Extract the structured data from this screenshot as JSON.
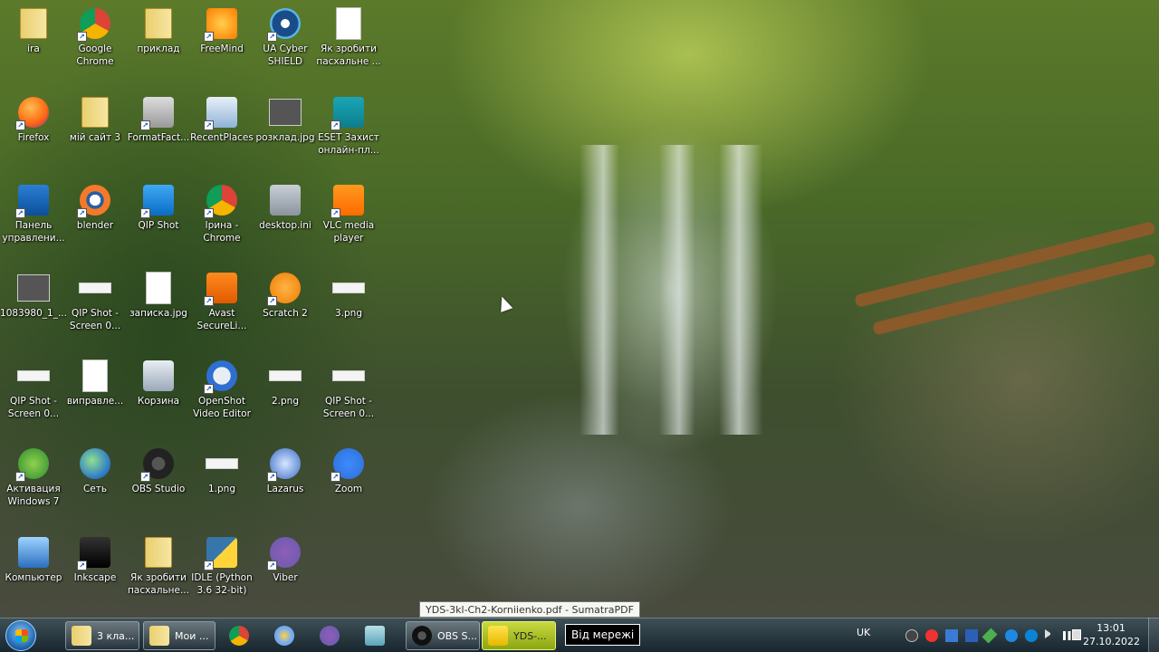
{
  "desktop": {
    "icons": [
      {
        "label": "ira",
        "icon": "user-folder-icon"
      },
      {
        "label": "Firefox",
        "icon": "firefox-icon",
        "shortcut": true
      },
      {
        "label": "Панель\nуправлени...",
        "icon": "control-panel-icon",
        "shortcut": true
      },
      {
        "label": "1083980_1_...",
        "icon": "image-thumbnail-icon"
      },
      {
        "label": "QIP Shot -\nScreen 0...",
        "icon": "screenshot-thumbnail-icon"
      },
      {
        "label": "Активация\nWindows 7",
        "icon": "activation-icon",
        "shortcut": true
      },
      {
        "label": "Компьютер",
        "icon": "computer-icon"
      },
      {
        "label": "Google\nChrome",
        "icon": "chrome-icon",
        "shortcut": true
      },
      {
        "label": "мій сайт 3",
        "icon": "folder-icon"
      },
      {
        "label": "blender",
        "icon": "blender-icon",
        "shortcut": true
      },
      {
        "label": "QIP Shot -\nScreen 0...",
        "icon": "screenshot-thumbnail-icon"
      },
      {
        "label": "виправле...",
        "icon": "document-thumbnail-icon"
      },
      {
        "label": "Сеть",
        "icon": "network-globe-icon"
      },
      {
        "label": "Inkscape",
        "icon": "inkscape-icon",
        "shortcut": true
      },
      {
        "label": "приклад",
        "icon": "folder-icon"
      },
      {
        "label": "FormatFact...",
        "icon": "format-factory-icon",
        "shortcut": true
      },
      {
        "label": "QIP Shot",
        "icon": "qip-shot-icon",
        "shortcut": true
      },
      {
        "label": "записка.jpg",
        "icon": "document-thumbnail-icon"
      },
      {
        "label": "Корзина",
        "icon": "recycle-bin-icon"
      },
      {
        "label": "OBS Studio",
        "icon": "obs-icon",
        "shortcut": true
      },
      {
        "label": "Як зробити\nпасхальне...",
        "icon": "folder-icon"
      },
      {
        "label": "FreeMind",
        "icon": "freemind-butterfly-icon",
        "shortcut": true
      },
      {
        "label": "RecentPlaces",
        "icon": "recent-places-icon",
        "shortcut": true
      },
      {
        "label": "Ірина -\nChrome",
        "icon": "chrome-profile-icon",
        "shortcut": true
      },
      {
        "label": "Avast\nSecureLi...",
        "icon": "avast-icon",
        "shortcut": true
      },
      {
        "label": "OpenShot\nVideo Editor",
        "icon": "openshot-icon",
        "shortcut": true
      },
      {
        "label": "1.png",
        "icon": "png-thumbnail-icon"
      },
      {
        "label": "IDLE (Python\n3.6 32-bit)",
        "icon": "python-idle-icon",
        "shortcut": true
      },
      {
        "label": "UA Cyber\nSHIELD",
        "icon": "ua-cyber-shield-icon",
        "shortcut": true
      },
      {
        "label": "розклад.jpg",
        "icon": "image-thumbnail-icon"
      },
      {
        "label": "desktop.ini",
        "icon": "ini-file-icon"
      },
      {
        "label": "Scratch 2",
        "icon": "scratch-icon",
        "shortcut": true
      },
      {
        "label": "2.png",
        "icon": "png-thumbnail-icon"
      },
      {
        "label": "Lazarus",
        "icon": "lazarus-icon",
        "shortcut": true
      },
      {
        "label": "Viber",
        "icon": "viber-icon",
        "shortcut": true
      },
      {
        "label": "Як зробити\nпасхальне ...",
        "icon": "blank-document-icon"
      },
      {
        "label": "ESET Захист\nонлайн-пл...",
        "icon": "eset-icon",
        "shortcut": true
      },
      {
        "label": "VLC media\nplayer",
        "icon": "vlc-cone-icon",
        "shortcut": true
      },
      {
        "label": "3.png",
        "icon": "png-thumbnail-icon"
      },
      {
        "label": "QIP Shot -\nScreen 0...",
        "icon": "screenshot-thumbnail-icon"
      },
      {
        "label": "Zoom",
        "icon": "zoom-icon",
        "shortcut": true
      }
    ]
  },
  "tooltip": {
    "text": "YDS-3kl-Ch2-Korniienko.pdf - SumatraPDF"
  },
  "network_popup": {
    "text": "Від мережі"
  },
  "taskbar": {
    "items": [
      {
        "label": "3 кла...",
        "icon": "folder-icon"
      },
      {
        "label": "Мои ...",
        "icon": "folder-icon"
      },
      {
        "label": "",
        "icon": "chrome-icon"
      },
      {
        "label": "",
        "icon": "paint-palette-icon"
      },
      {
        "label": "",
        "icon": "viber-icon"
      },
      {
        "label": "",
        "icon": "notebook-icon"
      },
      {
        "label": "OBS S...",
        "icon": "obs-icon"
      },
      {
        "label": "YDS-...",
        "icon": "sumatra-pdf-icon"
      }
    ],
    "tray": {
      "language": "UK",
      "time": "13:01",
      "date": "27.10.2022"
    }
  }
}
